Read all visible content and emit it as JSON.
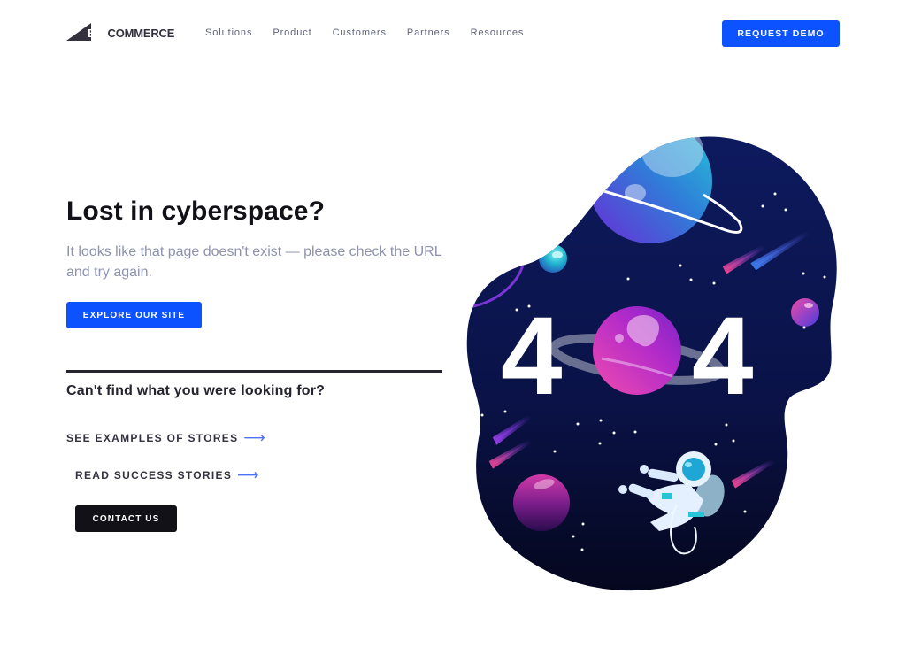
{
  "header": {
    "logo": {
      "big": "BIG",
      "commerce": "COMMERCE"
    },
    "nav": [
      {
        "label": "Solutions"
      },
      {
        "label": "Product"
      },
      {
        "label": "Customers"
      },
      {
        "label": "Partners"
      },
      {
        "label": "Resources"
      }
    ],
    "request_demo_label": "REQUEST DEMO"
  },
  "main": {
    "title": "Lost in cyberspace?",
    "subtitle": "It looks like that page doesn't exist — please check the URL and try again.",
    "explore_label": "EXPLORE OUR SITE",
    "help_heading": "Can't find what you were looking for?",
    "links": [
      {
        "label": "SEE EXAMPLES OF STORES",
        "icon": "arrow-right-icon",
        "glyph": "⟶"
      },
      {
        "label": "READ SUCCESS STORIES",
        "icon": "arrow-right-icon",
        "glyph": "⟶"
      }
    ],
    "contact_label": "CONTACT US"
  },
  "illustration": {
    "error_code_left": "4",
    "error_code_right": "4",
    "description": "404 space scene with planets, comets and astronaut"
  },
  "colors": {
    "accent": "#0d52ff",
    "dark": "#121118",
    "space_bg": "#0b1651",
    "link_arrow": "#4b71fc",
    "muted_text": "#8c93ad"
  }
}
